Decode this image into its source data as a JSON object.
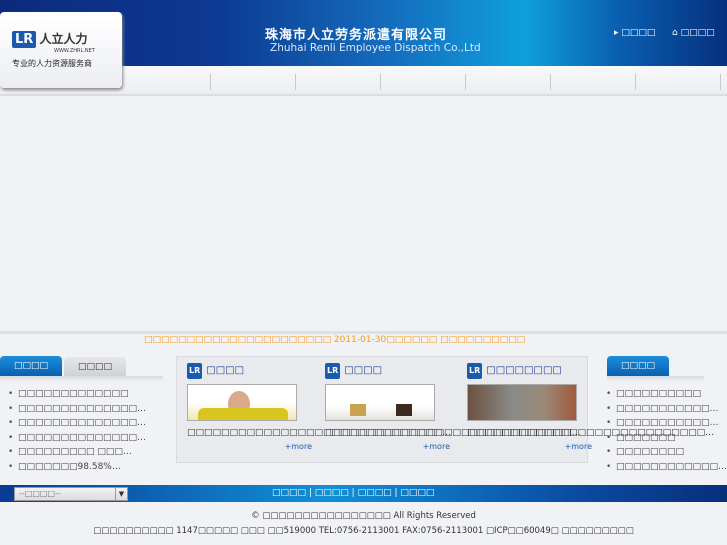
{
  "header": {
    "logo_brand": "人立人力",
    "logo_url": "WWW.ZHRL.NET",
    "logo_slogan": "专业的人力资源服务商",
    "title_cn": "珠海市人立劳务派遣有限公司",
    "title_en": "Zhuhai Renli Employee Dispatch Co.,Ltd",
    "link1": "□□□□",
    "link2": "□□□□"
  },
  "marquee": "□□□□□□□□□□□□□□□□□□□□□□ 2011-01-30□□□□□□ □□□□□□□□□□",
  "left_panel": {
    "tabs": [
      "□□□□",
      "□□□□"
    ],
    "items": [
      "□□□□□□□□□□□□□",
      "□□□□□□□□□□□□□□…",
      "□□□□□□□□□□□□□□…",
      "□□□□□□□□□□□□□□…",
      "□□□□□□□□□ □□□…",
      "□□□□□□□98.58%…"
    ]
  },
  "cards": [
    {
      "title": "□□□□",
      "text": "□□□□□□□□□□□□□□□□□□□□□□□□□□□□□□…",
      "more": "+more"
    },
    {
      "title": "□□□□",
      "text": "□□□□□□□□□□□□□□□□□□□□□□□□□□□□□…",
      "more": "+more"
    },
    {
      "title": "□□□□□□□□",
      "text": "□□□□□□□□□□□□□□□□□□□□□□□□□□□□…",
      "more": "+more"
    }
  ],
  "right_panel": {
    "tab": "□□□□",
    "items": [
      "□□□□□□□□□□",
      "□□□□□□□□□□□…",
      "□□□□□□□□□□□…",
      "□□□□□□□",
      "□□□□□□□□",
      "□□□□□□□□□□□□…"
    ]
  },
  "footer": {
    "select_value": "--□□□□--",
    "nav": [
      "□□□□",
      "□□□□",
      "□□□□",
      "□□□□"
    ],
    "copyright": "© □□□□□□□□□□□□□□□□ All Rights Reserved",
    "address": "□□□□□□□□□□ 1147□□□□□ □□□ □□519000 TEL:0756-2113001 FAX:0756-2113001 □ICP□□60049□ □□□□□□□□□"
  }
}
